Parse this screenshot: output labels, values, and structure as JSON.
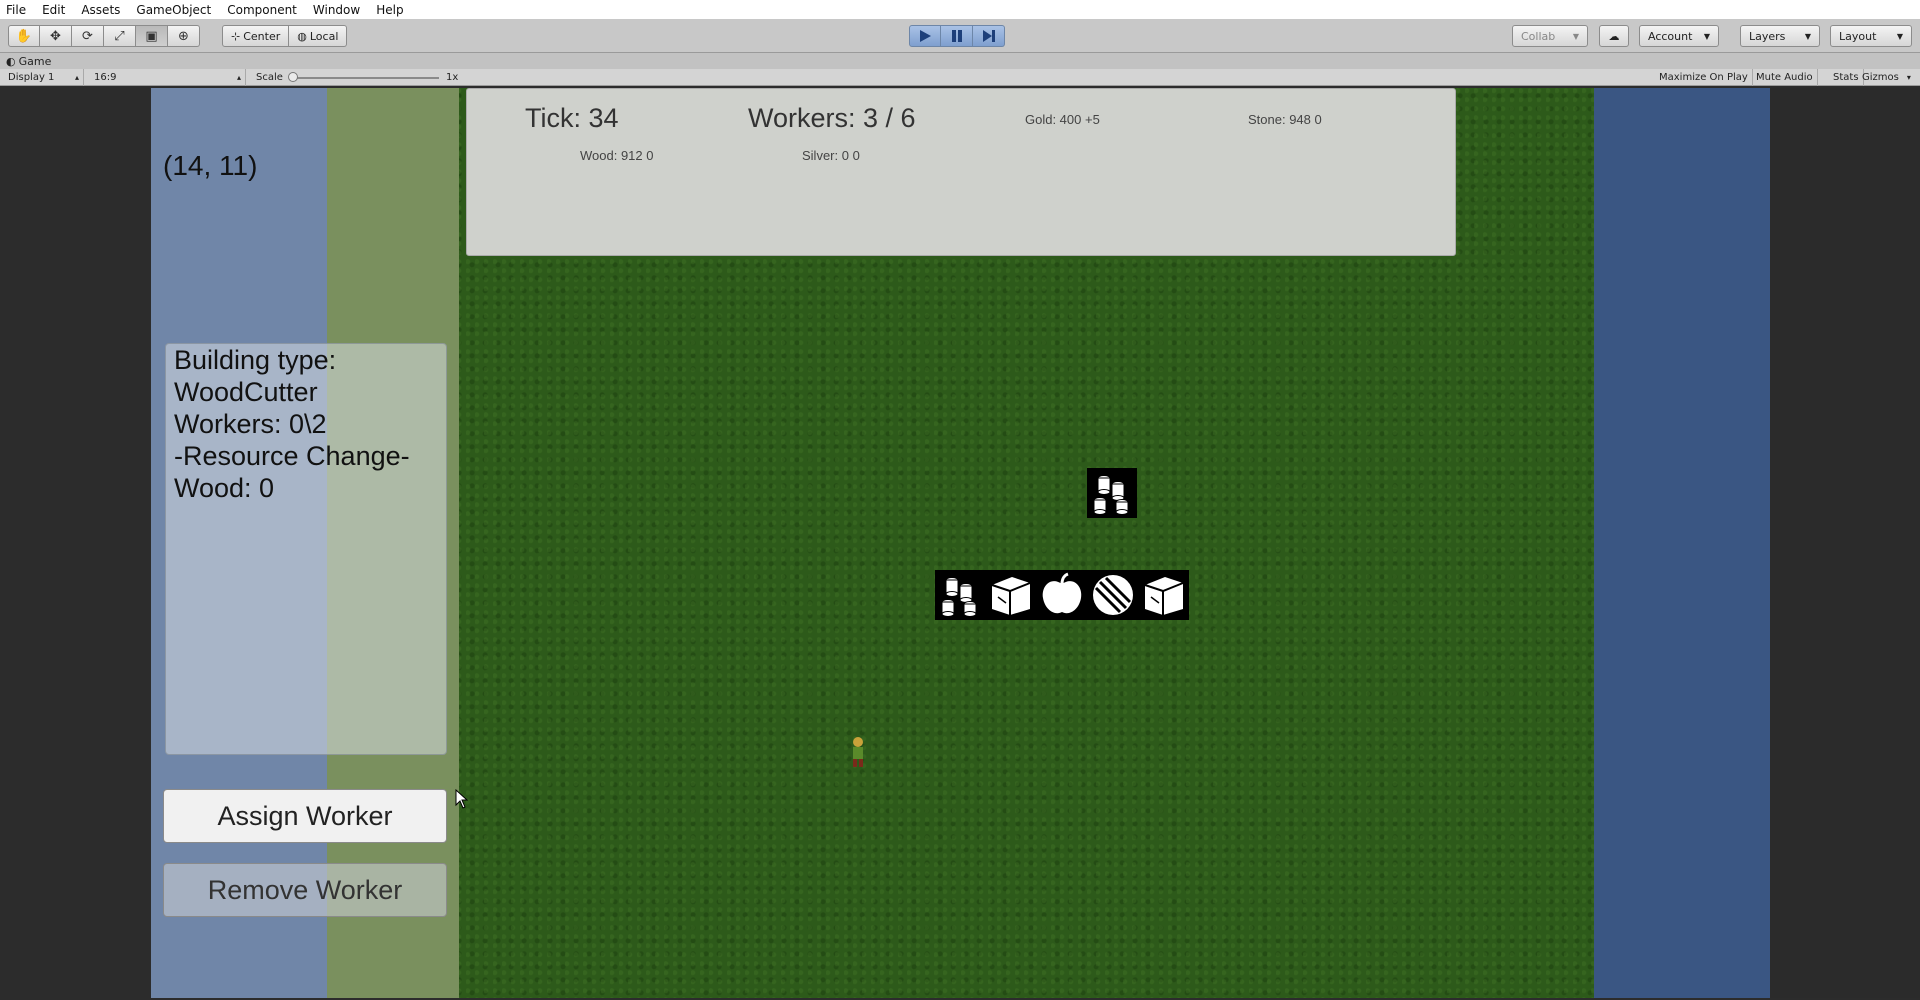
{
  "menu": [
    "File",
    "Edit",
    "Assets",
    "GameObject",
    "Component",
    "Window",
    "Help"
  ],
  "toolbar": {
    "pivot_center": "Center",
    "pivot_local": "Local",
    "collab": "Collab",
    "account": "Account",
    "layers": "Layers",
    "layout": "Layout"
  },
  "game_tab": {
    "title": "Game",
    "display": "Display 1",
    "aspect": "16:9",
    "scale_label": "Scale",
    "scale_value": "1x",
    "maximize": "Maximize On Play",
    "mute": "Mute Audio",
    "stats": "Stats",
    "gizmos": "Gizmos"
  },
  "colors": {
    "grass": "#2d5a1a",
    "water_left": "#7086a8",
    "water_right": "#3a5683",
    "play_active": "#7f9fcf"
  },
  "game": {
    "coordinate": "(14, 11)",
    "info_lines": [
      "Building type:",
      "WoodCutter",
      "",
      "Workers: 0\\2",
      "-Resource Change-",
      "Wood: 0"
    ],
    "assign_button": "Assign Worker",
    "remove_button": "Remove Worker",
    "hud": {
      "tick": "Tick: 34",
      "workers": "Workers: 3 / 6",
      "gold": "Gold: 400 +5",
      "stone": "Stone: 948 0",
      "wood": "Wood: 912 0",
      "silver": "Silver: 0 0"
    },
    "resource_icons_single": [
      "coins-icon"
    ],
    "resource_icons_row": [
      "coins-icon",
      "crate-icon",
      "apple-icon",
      "ore-icon",
      "crate-icon"
    ]
  }
}
